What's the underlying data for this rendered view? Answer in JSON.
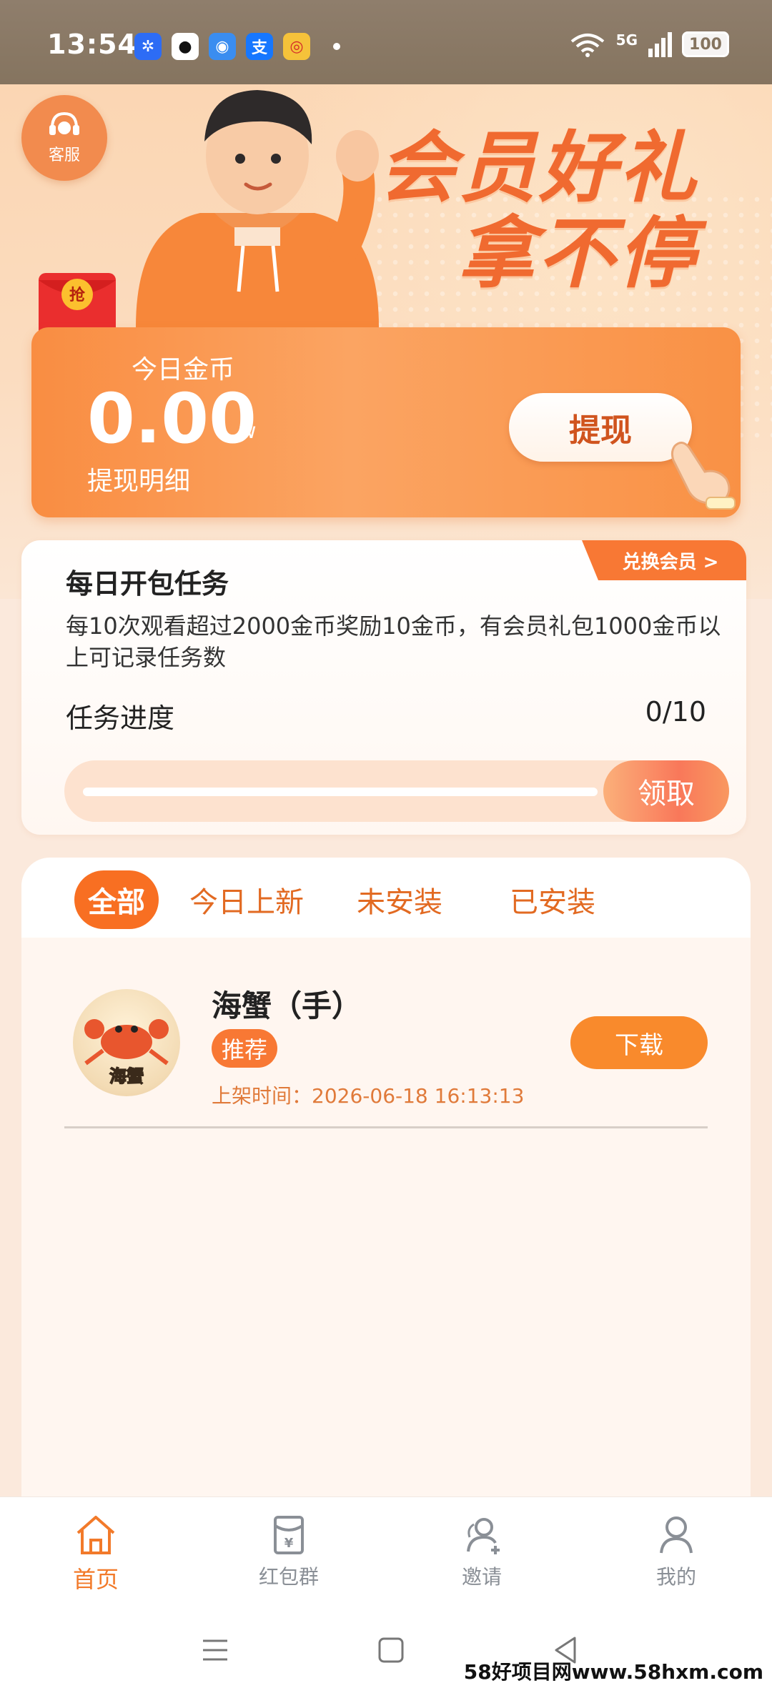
{
  "status_bar": {
    "time": "13:54",
    "network": "5G",
    "battery": "100",
    "apps": [
      {
        "icon": "pinwheel-app-icon",
        "color": "#2d6cf5",
        "glyph": "✲"
      },
      {
        "icon": "qq-app-icon",
        "color": "#ffffff",
        "glyph": "🐧"
      },
      {
        "icon": "browser-app-icon",
        "color": "#3a8df0",
        "glyph": "◉"
      },
      {
        "icon": "alipay-app-icon",
        "color": "#1677ff",
        "glyph": "支"
      },
      {
        "icon": "weibo-app-icon",
        "color": "#f5c23a",
        "glyph": "◎"
      }
    ]
  },
  "hero": {
    "customer_service_label": "客服",
    "slogan_line1": "会员好礼",
    "slogan_line2": "拿不停",
    "redpacket_glyph": "抢"
  },
  "coin_card": {
    "label": "今日金币",
    "value": "0.00",
    "unit": "w",
    "detail_link": "提现明细",
    "withdraw_button": "提现"
  },
  "task_card": {
    "exchange_tag": "兑换会员 >",
    "title": "每日开包任务",
    "description": "每10次观看超过2000金币奖励10金币，有会员礼包1000金币以上可记录任务数",
    "progress_label": "任务进度",
    "progress_count": "0/10",
    "progress_fraction": 0,
    "claim_button": "领取"
  },
  "tabs": [
    {
      "label": "全部",
      "active": true
    },
    {
      "label": "今日上新",
      "active": false
    },
    {
      "label": "未安装",
      "active": false
    },
    {
      "label": "已安装",
      "active": false
    }
  ],
  "items": [
    {
      "name": "海蟹（手）",
      "avatar_text": "海蟹",
      "badge": "推荐",
      "time_label": "上架时间：",
      "time": "2026-06-18 16:13:13",
      "download_button": "下载"
    }
  ],
  "bottom_nav": [
    {
      "label": "首页",
      "icon": "home-icon",
      "active": true
    },
    {
      "label": "红包群",
      "icon": "red-envelope-icon",
      "active": false
    },
    {
      "label": "邀请",
      "icon": "invite-icon",
      "active": false
    },
    {
      "label": "我的",
      "icon": "profile-icon",
      "active": false
    }
  ],
  "colors": {
    "accent": "#f87834",
    "accent_text": "#e26a22",
    "card_gradient_start": "#f98d42",
    "status_bar": "#8a7965"
  },
  "watermark": "58好项目网www.58hxm.com"
}
